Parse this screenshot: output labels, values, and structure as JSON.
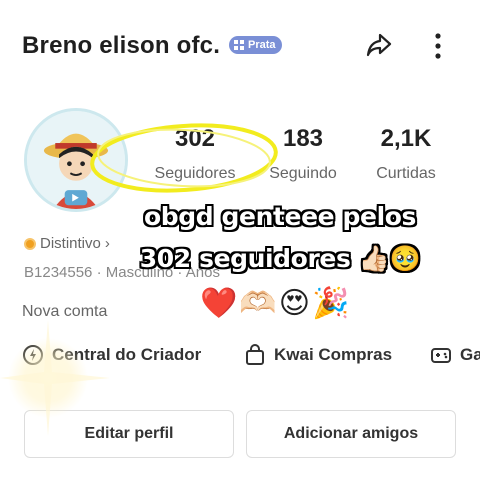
{
  "profile": {
    "name": "Breno elison ofc.",
    "badge_label": "Prata",
    "badge_color": "#7a8fd6",
    "distintivo": "Distintivo",
    "info": "B1234556 · Masculino · Anos",
    "bio": "Nova comta"
  },
  "icons": {
    "share": "share-icon",
    "more": "more-vertical-icon",
    "creator": "creator-center-icon",
    "shop": "shopping-bag-icon",
    "game": "game-icon"
  },
  "stats": [
    {
      "value": "302",
      "label": "Seguidores"
    },
    {
      "value": "183",
      "label": "Seguindo"
    },
    {
      "value": "2,1K",
      "label": "Curtidas"
    }
  ],
  "overlay": {
    "line1": "obgd genteee pelos",
    "line2": "302 seguidores 👍🏻🥹",
    "emojis": "❤️🫶🏻😍🎉"
  },
  "actions": {
    "creator": "Central do Criador",
    "shop": "Kwai Compras",
    "game": "Ga"
  },
  "buttons": {
    "edit": "Editar perfil",
    "add_friends": "Adicionar amigos"
  },
  "colors": {
    "highlight": "#f2ec1e",
    "badge": "#7a8fd6"
  }
}
